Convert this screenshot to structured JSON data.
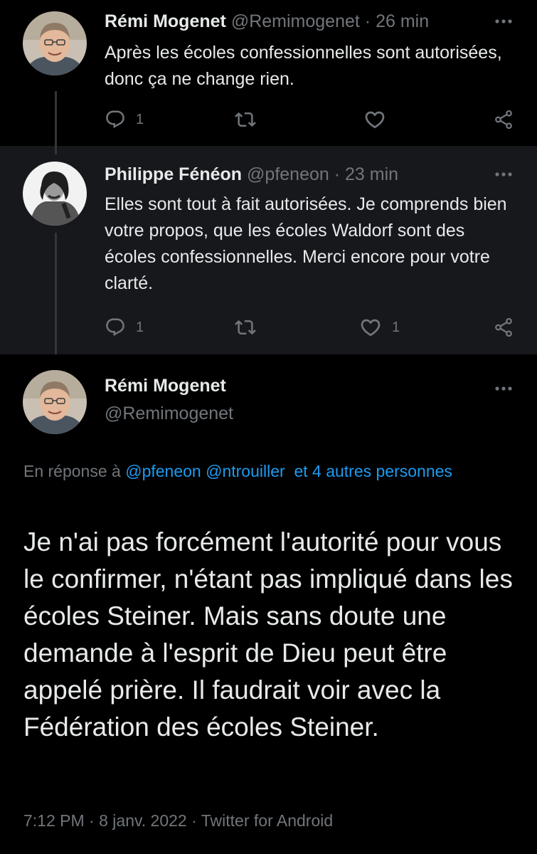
{
  "tweets": [
    {
      "name": "Rémi Mogenet",
      "handle": "@Remimogenet",
      "time": "26 min",
      "text": "Après les écoles confessionnelles sont autorisées, donc ça ne change rien.",
      "replies": "1",
      "retweets": "",
      "likes": "",
      "avatar": "avatar-remi"
    },
    {
      "name": "Philippe Fénéon",
      "handle": "@pfeneon",
      "time": "23 min",
      "text": "Elles sont tout à fait autorisées. Je comprends bien votre propos, que les écoles Waldorf sont des écoles confessionnelles. Merci encore pour votre clarté.",
      "replies": "1",
      "retweets": "",
      "likes": "1",
      "avatar": "avatar-philippe"
    }
  ],
  "main": {
    "name": "Rémi Mogenet",
    "handle": "@Remimogenet",
    "reply_prefix": "En réponse à",
    "reply_user1": "@pfeneon",
    "reply_user2": "@ntrouiller",
    "reply_others": "et 4 autres personnes",
    "text": "Je n'ai pas forcément l'autorité pour vous le confirmer, n'étant pas impliqué dans les écoles Steiner. Mais sans doute une demande à l'esprit de Dieu peut être appelé prière. Il faudrait voir avec la Fédération des écoles Steiner.",
    "time": "7:12 PM",
    "date": "8 janv. 2022",
    "source": "Twitter for Android"
  },
  "separator": "·",
  "colors": {
    "background": "#000000",
    "highlight_background": "#16181c",
    "text": "#e7e9ea",
    "muted": "#71767b",
    "link": "#1d9bf0",
    "thread_line": "#333639"
  }
}
